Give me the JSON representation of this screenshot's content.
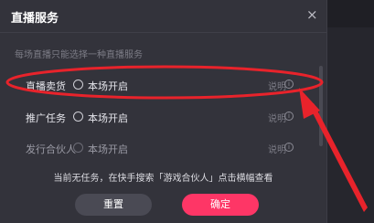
{
  "dialog": {
    "title": "直播服务",
    "close_glyph": "×",
    "subtitle": "每场直播只能选择一种直播服务",
    "rows": [
      {
        "label": "直播卖货",
        "option": "本场开启",
        "help": "说明",
        "info_glyph": "i",
        "enabled": true
      },
      {
        "label": "推广任务",
        "option": "本场开启",
        "help": "说明",
        "info_glyph": "i",
        "enabled": true
      },
      {
        "label": "发行合伙人",
        "option": "本场开启",
        "help": "说明",
        "info_glyph": "i",
        "enabled": false
      }
    ],
    "notice": "当前无任务，在快手搜索「游戏合伙人」点击横幅查看",
    "reset_label": "重置",
    "confirm_label": "确定"
  },
  "colors": {
    "dialog_bg": "#33333b",
    "accent": "#fe3666",
    "annotation_red": "#e8232b"
  }
}
